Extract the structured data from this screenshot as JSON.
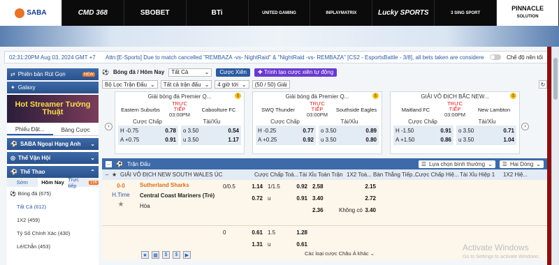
{
  "logos": [
    "SABA",
    "CMD 368",
    "SBOBET",
    "BTi",
    "UNITED GAMING",
    "INPLAYMATRIX",
    "Lucky SPORTS",
    "3 SING SPORT",
    "PINNACLE",
    "SOLUTION"
  ],
  "infobar": {
    "time": "02:31:20PM Aug 03, 2024 GMT +7",
    "attn": "Attn:[E-Sports] Due to match cancelled \"REMBAZA -vs- NightRaid\" & \"NightRaid -vs- REMBAZA\" [CS2 - EsportsBattle - 3/8], all bets taken are considered",
    "mode": "Chế độ nền tối"
  },
  "sidebar": {
    "version_btn": "Phiên bản Rút Gọn",
    "badge_new": "NEW",
    "galaxy_btn": "Galaxy",
    "promo": "Hot Streamer Tướng Thuật",
    "tabs": [
      "Phiếu Đặt...",
      "Bảng Cược"
    ],
    "sections": [
      "SABA Ngoại Hạng Anh",
      "Thể Vận Hội",
      "Thể Thao"
    ],
    "subtabs": [
      "Sớm",
      "Hôm Nay",
      "Trực tiếp"
    ],
    "live_count": "156",
    "sport": "Bóng đá",
    "sport_count": "(675)",
    "items": [
      "Tất Cả",
      "(612)",
      "1X2",
      "(459)",
      "Tỷ Số Chính Xác",
      "(430)",
      "Lẻ/Chẵn",
      "(453)"
    ]
  },
  "toolbar": {
    "breadcrumb": "Bóng đá / Hôm Nay",
    "select_all": "Tất Cả",
    "parlay_btn": "Cược Xiên",
    "auto_parlay_btn": "Trình tạo cược xiên tự động",
    "filter1": "Bộ Lọc Trận Đấu",
    "filter2": "Tất cả trận đấu",
    "filter3": "4 giờ tới",
    "filter4": "(50 / 50) Giải"
  },
  "cards": [
    {
      "league": "Giải bóng đá Premier Q...",
      "home": "Eastern Suburbs",
      "away": "Caboolture FC",
      "live": "TRỰC TIẾP",
      "time": "03:00PM",
      "hdp": [
        [
          "H -0.75",
          "0.78"
        ],
        [
          "A +0.75",
          "0.91"
        ]
      ],
      "ou": [
        [
          "o 3.50",
          "0.54"
        ],
        [
          "u 3.50",
          "1.17"
        ]
      ]
    },
    {
      "league": "Giải bóng đá Premier Q...",
      "home": "SWQ Thunder",
      "away": "Southside Eagles",
      "live": "TRỰC TIẾP",
      "time": "03:00PM",
      "hdp": [
        [
          "H -0.25",
          "0.77"
        ],
        [
          "A +0.25",
          "0.92"
        ]
      ],
      "ou": [
        [
          "o 3.50",
          "0.89"
        ],
        [
          "u 3.50",
          "0.80"
        ]
      ]
    },
    {
      "league": "GIẢI VÔ ĐỊCH BẮC NEW...",
      "home": "Maitland FC",
      "away": "New Lambton",
      "live": "TRỰC TIẾP",
      "time": "03:00PM",
      "hdp": [
        [
          "H -1.50",
          "0.91"
        ],
        [
          "A +1.50",
          "0.86"
        ]
      ],
      "ou": [
        [
          "o 3.50",
          "0.71"
        ],
        [
          "u 3.50",
          "1.04"
        ]
      ]
    }
  ],
  "card_labels": {
    "hdp": "Cược Chấp",
    "ou": "Tài/Xỉu"
  },
  "table": {
    "title": "Trận Đấu",
    "sort": "Lựa chọn bình thường",
    "lines": "Hai Dòng",
    "league": "GIẢI VÔ ĐỊCH NEW SOUTH WALES ÚC",
    "cols": [
      "Cược Chấp Toà...",
      "Tài Xỉu Toàn Trận",
      "1X2 Toà...",
      "Bàn Thắng Tiếp...",
      "Cược Chấp Hiệ...",
      "Tài Xỉu Hiệp 1",
      "1X2 Hiệ..."
    ],
    "score": "0-0",
    "period": "H.Time",
    "home": "Sutherland Sharks",
    "away": "Central Coast Mariners (Trẻ)",
    "draw": "Hòa",
    "r1": {
      "hdp_line": "0/0.5",
      "hdp_h": "1.14",
      "ou_line": "1/1.5",
      "ou_o": "0.92",
      "x12_h": "2.58",
      "ng": "2.15"
    },
    "r2": {
      "hdp_a": "0.72",
      "ou_u": "u",
      "ou_u_val": "0.91",
      "x12_a": "3.40",
      "ng": "2.72"
    },
    "r3": {
      "x12_d": "2.36",
      "ng_label": "Không có",
      "ng": "3.40"
    },
    "s1": {
      "hdp_line": "0",
      "hdp_h": "0.61",
      "ou_line": "1.5",
      "ou_o": "1.28"
    },
    "s2": {
      "hdp_a": "1.31",
      "ou_u": "u",
      "ou_u_val": "0.61"
    },
    "more": "Các loại cược Châu Á khác"
  },
  "watermark": {
    "line1": "Activate Windows",
    "line2": "Go to Settings to activate Windows."
  }
}
